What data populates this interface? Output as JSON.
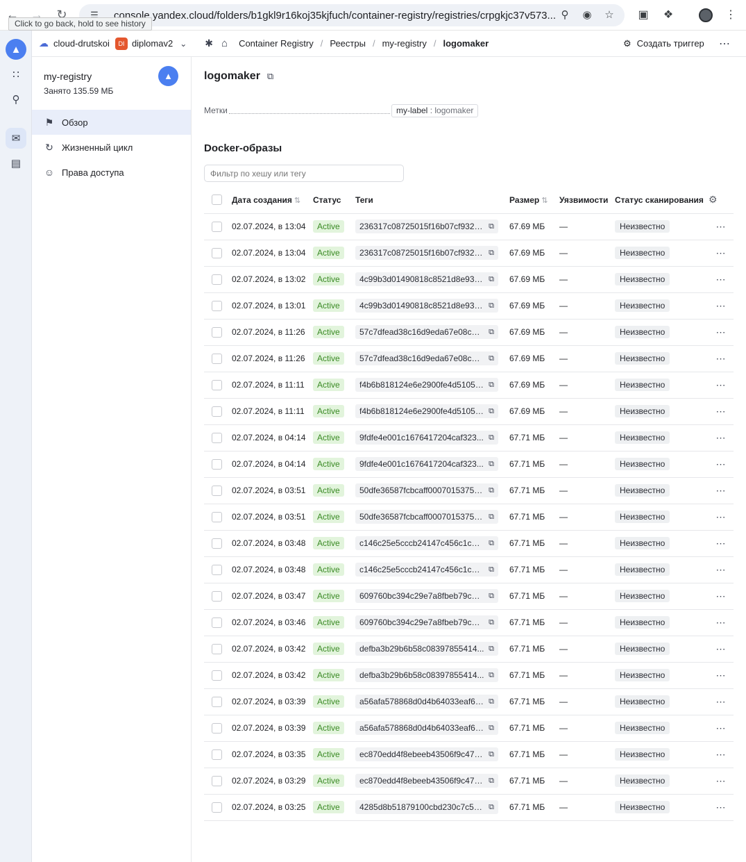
{
  "browser": {
    "url": "console.yandex.cloud/folders/b1gkl9r16koj35kjfuch/container-registry/registries/crpgkjc37v573...",
    "back_tooltip": "Click to go back, hold to see history"
  },
  "header": {
    "cloud": "cloud-drutskoi",
    "folder_badge": "DI",
    "folder": "diplomav2",
    "breadcrumbs": [
      "Container Registry",
      "Реестры",
      "my-registry",
      "logomaker"
    ],
    "create_trigger": "Создать триггер"
  },
  "sidebar": {
    "registry_name": "my-registry",
    "registry_used": "Занято 135.59 МБ",
    "items": [
      {
        "label": "Обзор"
      },
      {
        "label": "Жизненный цикл"
      },
      {
        "label": "Права доступа"
      }
    ]
  },
  "main": {
    "title": "logomaker",
    "labels_caption": "Метки",
    "label_key": "my-label",
    "label_value": "logomaker",
    "section_title": "Docker-образы",
    "filter_placeholder": "Фильтр по хешу или тегу",
    "columns": [
      "Дата создания",
      "Статус",
      "Теги",
      "Размер",
      "Уязвимости",
      "Статус сканирования"
    ],
    "rows": [
      {
        "date": "02.07.2024, в 13:04",
        "status": "Active",
        "tag": "236317c08725015f16b07cf9323...",
        "size": "67.69 МБ",
        "vuln": "—",
        "scan": "Неизвестно"
      },
      {
        "date": "02.07.2024, в 13:04",
        "status": "Active",
        "tag": "236317c08725015f16b07cf9323...",
        "size": "67.69 МБ",
        "vuln": "—",
        "scan": "Неизвестно"
      },
      {
        "date": "02.07.2024, в 13:02",
        "status": "Active",
        "tag": "4c99b3d01490818c8521d8e937...",
        "size": "67.69 МБ",
        "vuln": "—",
        "scan": "Неизвестно"
      },
      {
        "date": "02.07.2024, в 13:01",
        "status": "Active",
        "tag": "4c99b3d01490818c8521d8e937...",
        "size": "67.69 МБ",
        "vuln": "—",
        "scan": "Неизвестно"
      },
      {
        "date": "02.07.2024, в 11:26",
        "status": "Active",
        "tag": "57c7dfead38c16d9eda67e08c40...",
        "size": "67.69 МБ",
        "vuln": "—",
        "scan": "Неизвестно"
      },
      {
        "date": "02.07.2024, в 11:26",
        "status": "Active",
        "tag": "57c7dfead38c16d9eda67e08c40...",
        "size": "67.69 МБ",
        "vuln": "—",
        "scan": "Неизвестно"
      },
      {
        "date": "02.07.2024, в 11:11",
        "status": "Active",
        "tag": "f4b6b818124e6e2900fe4d5105e...",
        "size": "67.69 МБ",
        "vuln": "—",
        "scan": "Неизвестно"
      },
      {
        "date": "02.07.2024, в 11:11",
        "status": "Active",
        "tag": "f4b6b818124e6e2900fe4d5105e...",
        "size": "67.69 МБ",
        "vuln": "—",
        "scan": "Неизвестно"
      },
      {
        "date": "02.07.2024, в 04:14",
        "status": "Active",
        "tag": "9fdfe4e001c1676417204caf323...",
        "size": "67.71 МБ",
        "vuln": "—",
        "scan": "Неизвестно"
      },
      {
        "date": "02.07.2024, в 04:14",
        "status": "Active",
        "tag": "9fdfe4e001c1676417204caf323...",
        "size": "67.71 МБ",
        "vuln": "—",
        "scan": "Неизвестно"
      },
      {
        "date": "02.07.2024, в 03:51",
        "status": "Active",
        "tag": "50dfe36587fcbcaff00070153752...",
        "size": "67.71 МБ",
        "vuln": "—",
        "scan": "Неизвестно"
      },
      {
        "date": "02.07.2024, в 03:51",
        "status": "Active",
        "tag": "50dfe36587fcbcaff00070153752...",
        "size": "67.71 МБ",
        "vuln": "—",
        "scan": "Неизвестно"
      },
      {
        "date": "02.07.2024, в 03:48",
        "status": "Active",
        "tag": "c146c25e5cccb24147c456c1c64...",
        "size": "67.71 МБ",
        "vuln": "—",
        "scan": "Неизвестно"
      },
      {
        "date": "02.07.2024, в 03:48",
        "status": "Active",
        "tag": "c146c25e5cccb24147c456c1c64...",
        "size": "67.71 МБ",
        "vuln": "—",
        "scan": "Неизвестно"
      },
      {
        "date": "02.07.2024, в 03:47",
        "status": "Active",
        "tag": "609760bc394c29e7a8fbeb79ca3...",
        "size": "67.71 МБ",
        "vuln": "—",
        "scan": "Неизвестно"
      },
      {
        "date": "02.07.2024, в 03:46",
        "status": "Active",
        "tag": "609760bc394c29e7a8fbeb79ca3...",
        "size": "67.71 МБ",
        "vuln": "—",
        "scan": "Неизвестно"
      },
      {
        "date": "02.07.2024, в 03:42",
        "status": "Active",
        "tag": "defba3b29b6b58c08397855414...",
        "size": "67.71 МБ",
        "vuln": "—",
        "scan": "Неизвестно"
      },
      {
        "date": "02.07.2024, в 03:42",
        "status": "Active",
        "tag": "defba3b29b6b58c08397855414...",
        "size": "67.71 МБ",
        "vuln": "—",
        "scan": "Неизвестно"
      },
      {
        "date": "02.07.2024, в 03:39",
        "status": "Active",
        "tag": "a56afa578868d0d4b64033eaf6f...",
        "size": "67.71 МБ",
        "vuln": "—",
        "scan": "Неизвестно"
      },
      {
        "date": "02.07.2024, в 03:39",
        "status": "Active",
        "tag": "a56afa578868d0d4b64033eaf6f...",
        "size": "67.71 МБ",
        "vuln": "—",
        "scan": "Неизвестно"
      },
      {
        "date": "02.07.2024, в 03:35",
        "status": "Active",
        "tag": "ec870edd4f8ebeeb43506f9c479...",
        "size": "67.71 МБ",
        "vuln": "—",
        "scan": "Неизвестно"
      },
      {
        "date": "02.07.2024, в 03:29",
        "status": "Active",
        "tag": "ec870edd4f8ebeeb43506f9c479...",
        "size": "67.71 МБ",
        "vuln": "—",
        "scan": "Неизвестно"
      },
      {
        "date": "02.07.2024, в 03:25",
        "status": "Active",
        "tag": "4285d8b51879100cbd230c7c55...",
        "size": "67.71 МБ",
        "vuln": "—",
        "scan": "Неизвестно"
      }
    ]
  },
  "colors": {
    "accent": "#4b7ff0",
    "active_status_bg": "#e2f4dc",
    "active_status_text": "#3a8a24",
    "folder_badge": "#e4572e"
  },
  "icons": [
    "back-arrow-icon",
    "forward-arrow-icon",
    "reload-icon",
    "site-settings-icon",
    "zoom-icon",
    "eye-off-icon",
    "star-icon",
    "pip-icon",
    "extensions-icon",
    "profile-avatar",
    "kebab-icon",
    "registry-icon",
    "apps-grid-icon",
    "search-icon",
    "inbox-icon",
    "monitor-icon",
    "cloud-icon",
    "services-icon",
    "home-icon",
    "settings-icon",
    "flag-icon",
    "refresh-cycle-icon",
    "users-icon",
    "copy-icon",
    "sort-icon",
    "gear-icon",
    "more-dots-icon"
  ]
}
